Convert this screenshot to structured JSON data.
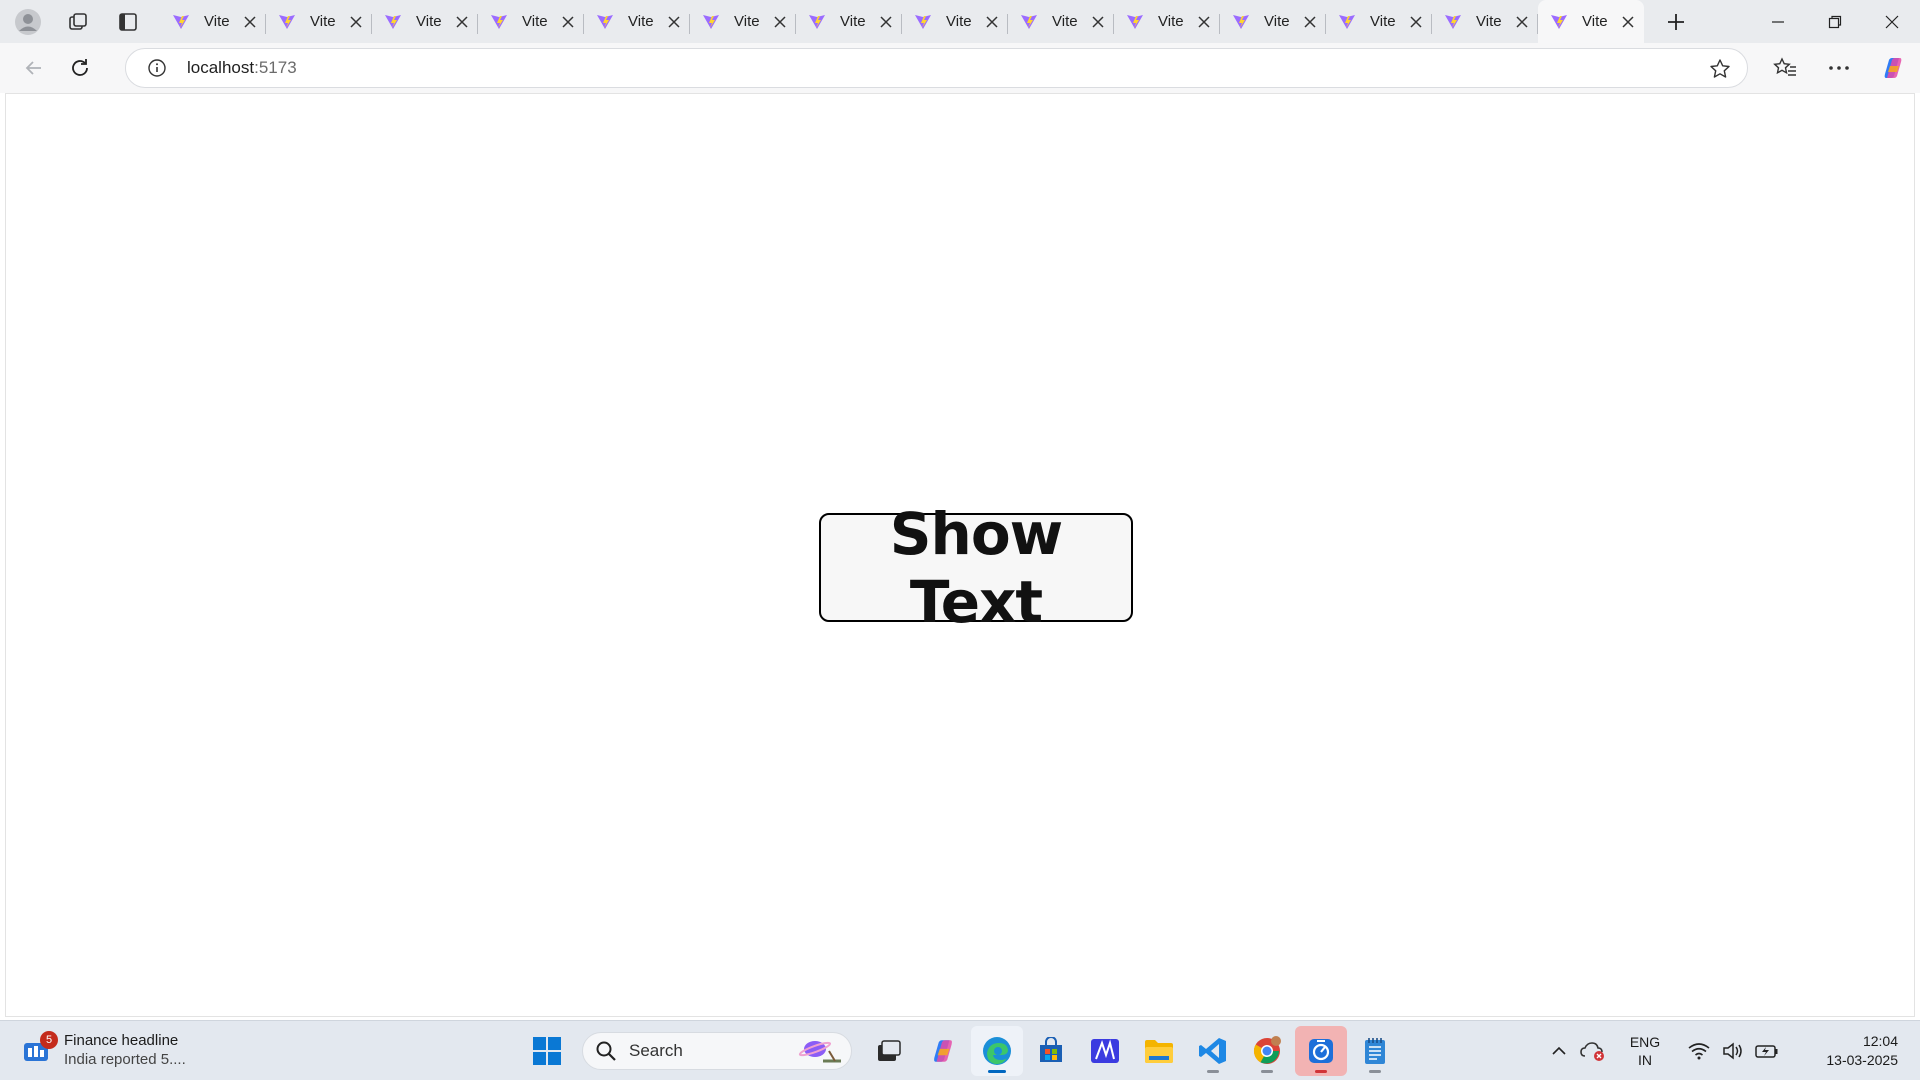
{
  "browser": {
    "tabs": [
      {
        "title": "Vite",
        "active": false
      },
      {
        "title": "Vite",
        "active": false
      },
      {
        "title": "Vite",
        "active": false
      },
      {
        "title": "Vite",
        "active": false
      },
      {
        "title": "Vite",
        "active": false
      },
      {
        "title": "Vite",
        "active": false
      },
      {
        "title": "Vite",
        "active": false
      },
      {
        "title": "Vite",
        "active": false
      },
      {
        "title": "Vite",
        "active": false
      },
      {
        "title": "Vite",
        "active": false
      },
      {
        "title": "Vite",
        "active": false
      },
      {
        "title": "Vite",
        "active": false
      },
      {
        "title": "Vite",
        "active": false
      },
      {
        "title": "Vite",
        "active": true
      }
    ],
    "address": {
      "host": "localhost",
      "port": ":5173"
    }
  },
  "page": {
    "button_label": "Show Text"
  },
  "taskbar": {
    "news": {
      "badge": "5",
      "title": "Finance headline",
      "subtitle": "India reported 5...."
    },
    "search_label": "Search",
    "language": {
      "line1": "ENG",
      "line2": "IN"
    },
    "clock": {
      "time": "12:04",
      "date": "13-03-2025"
    }
  },
  "colors": {
    "vite_purple": "#9b6bff",
    "vite_yellow": "#ffd62e",
    "accent": "#0067c0"
  }
}
